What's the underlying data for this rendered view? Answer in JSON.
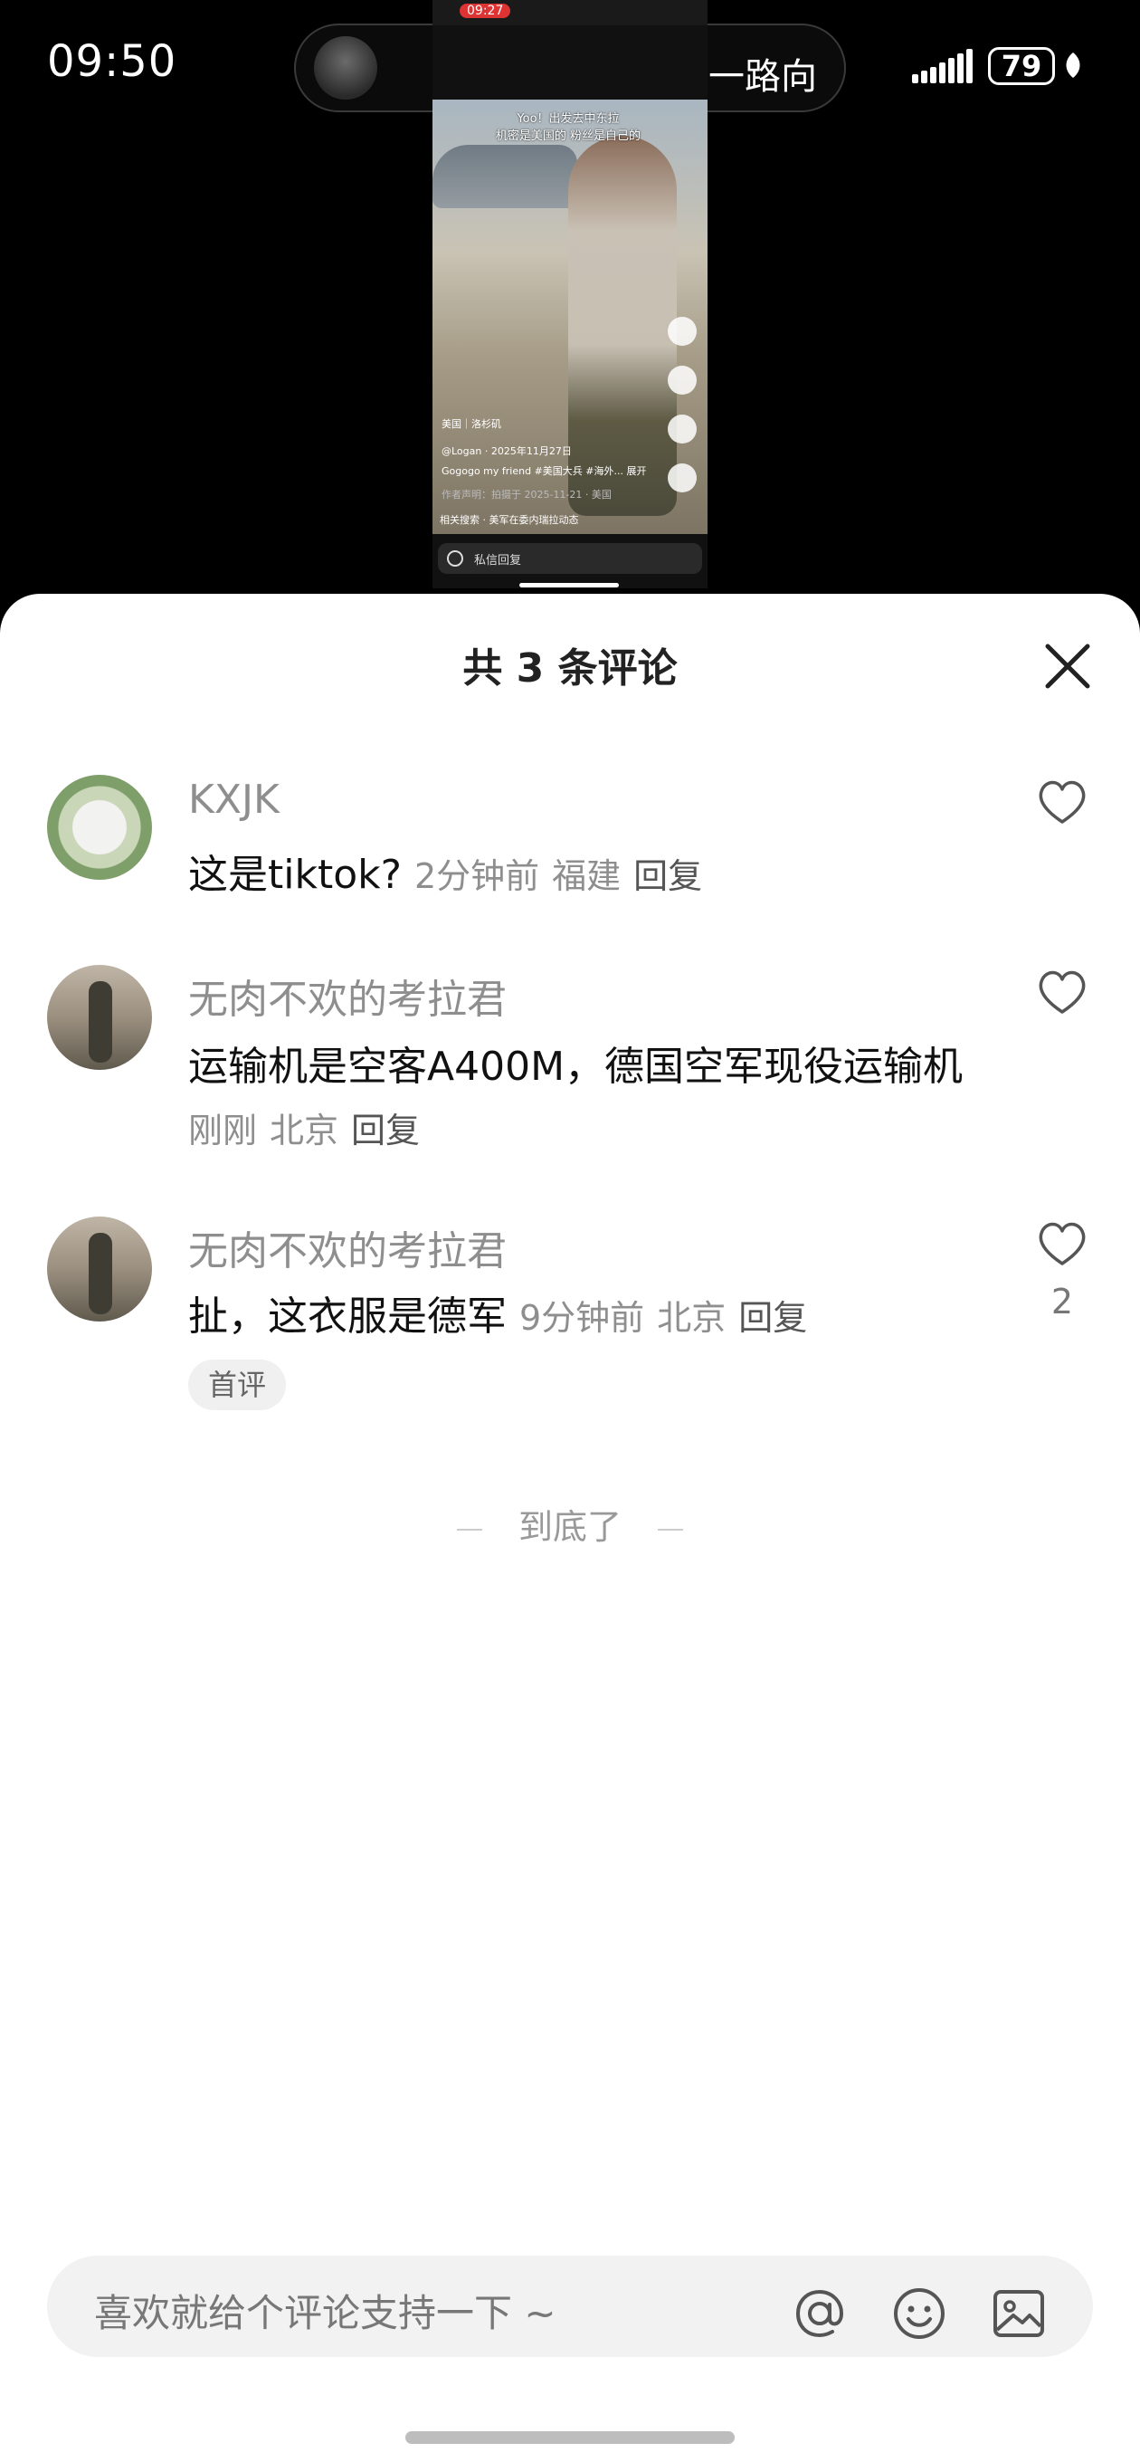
{
  "status_bar": {
    "time": "09:50",
    "battery": "79",
    "island_text": "一路向"
  },
  "video": {
    "phone_time": "09:27",
    "caption_line1": "Yoo！出发去中东拉",
    "caption_line2": "机密是美国的 粉丝是自己的",
    "location": "美国｜洛杉矶",
    "author": "@Logan · 2025年11月27日",
    "description": "Gogogo my friend #美国大兵 #海外... 展开",
    "meta": "作者声明：拍摄于 2025-11-21 · 美国",
    "related": "相关搜索 · 美军在委内瑞拉动态",
    "dm_label": "私信回复"
  },
  "sheet": {
    "title": "共 3 条评论",
    "comments": [
      {
        "user": "KXJK",
        "text": "这是tiktok?",
        "time": "2分钟前",
        "region": "福建",
        "reply": "回复",
        "likes": ""
      },
      {
        "user": "无肉不欢的考拉君",
        "text": "运输机是空客A400M，德国空军现役运输机",
        "time": "刚刚",
        "region": "北京",
        "reply": "回复",
        "likes": ""
      },
      {
        "user": "无肉不欢的考拉君",
        "text": "扯，这衣服是德军",
        "time": "9分钟前",
        "region": "北京",
        "reply": "回复",
        "likes": "2",
        "badge": "首评"
      }
    ],
    "end_text": "到底了",
    "input_placeholder": "喜欢就给个评论支持一下 ~"
  },
  "icons": {
    "close": "close-icon",
    "heart": "heart-icon",
    "at": "at-icon",
    "emoji": "emoji-icon",
    "image": "image-icon"
  }
}
